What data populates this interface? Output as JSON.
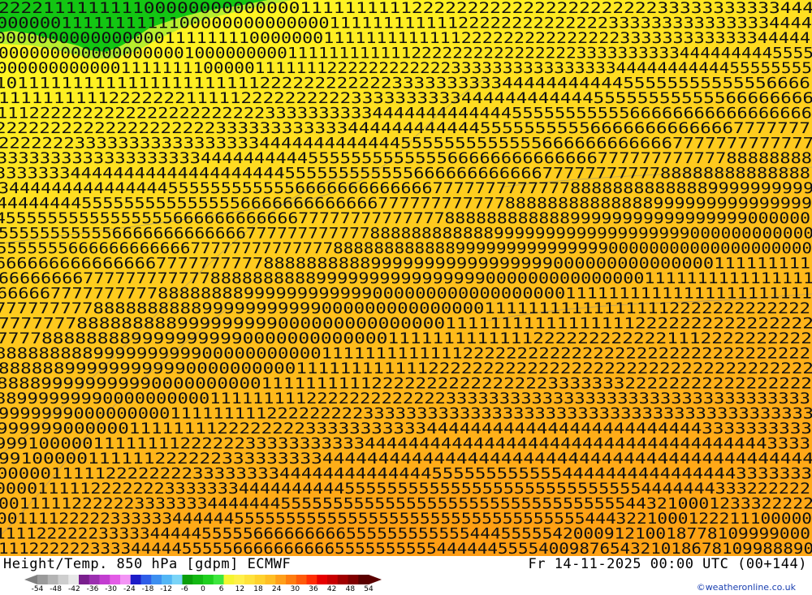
{
  "title": "Height/Temp. 850 hPa [gdpm] ECMWF",
  "valid_time": "Fr 14-11-2025 00:00 UTC (00+144)",
  "credit": "©weatheronline.co.uk",
  "legend": {
    "labels": [
      "-54",
      "-48",
      "-42",
      "-36",
      "-30",
      "-24",
      "-18",
      "-12",
      "-6",
      "0",
      "6",
      "12",
      "18",
      "24",
      "30",
      "36",
      "42",
      "48",
      "54"
    ],
    "colors": [
      "#9a9a9a",
      "#b4b4b4",
      "#cecece",
      "#e8e8e8",
      "#7a1f8e",
      "#9b2fb0",
      "#c23dd0",
      "#e35ce6",
      "#f394f5",
      "#1c1cc8",
      "#2f5ee8",
      "#3d8ff0",
      "#53b6f5",
      "#7ad4f7",
      "#0a9e0a",
      "#13b813",
      "#1fd01f",
      "#3ee63e",
      "#f5f532",
      "#fff04a",
      "#ffe23c",
      "#ffd22e",
      "#ffbe24",
      "#ff9f1a",
      "#ff7d10",
      "#ff5a0a",
      "#ff2e04",
      "#e60000",
      "#c80000",
      "#a00000",
      "#800000",
      "#5a0000"
    ]
  },
  "map": {
    "background_colors": {
      "cold_patch": "#18d018",
      "warm_yellow": "#ffff1e",
      "orange": "#ffb11a"
    },
    "digit_rows": [
      "2222111111111000000000000001111111111222222222222222222222233333333333444",
      "0000001111111111100000000000000111111111111222222222222223333333333333334444",
      "00000000000000001111111100000001111111111111222222222222222333333333333344444",
      "0000000000000000001000000000111111111111222222222222222233333333334444444445555",
      "0000000000001111111100000111111122222222222233333333333333334444444444455555555",
      "10111111111111111111111122222222222233333333334444444444455555555555556666",
      "11111111112222222111112222222222333333333344444444444455555555555566666666",
      "1112222222222222222222222333333333344444444444445555555555566666666666666666",
      "22222222222222222222333333333333444444444444555555555566666666666667777777",
      "222222233333333333333333444444444444455555555555556666666666667777777777777",
      "3333333333333333333444444444455555555555556666666666666677777777777788888888",
      "3333333444444444444444444445555555555556666666666667777777777788888888888888",
      "34444444444444445555555555556666666666666777777777777788888888888889999999999",
      "44444444555555555555555666666666666677777777777788888888888888999999999999999",
      "455555555555555556666666666667777777777777788888888888899999999999999999000000",
      "5555555555566666666666667777777777778888888888889999999999999999999000000000000",
      "55555556666666666667777777777777788888888888899999999999999900000000000000000000",
      "6666666666666667777777777888888888899999999999999999000000000000000111111111",
      "66666666777777777777888888888899999999999999990000000000000001111111111111111",
      "6666677777777778888888899999999999900000000000000000011111111111111111111111",
      "777777777888888888899999999999000000000000000111111111111111112222222222222",
      "7777777888888888999999999000000000000000111111111111111112222222222222222",
      "7777888888889999999999000000000000011111111111112222222222221112222222222",
      "888888888999999999900000000000111111111111122222222222222222222222222222222",
      "88888899999999999000000000011111111111122222222222222222222222222222222222",
      "88889999999999000000000011111111112222222222222222333333322222222222222222",
      "8899999999000000000011111111122222222222223333333333333333333333333333333333",
      "9999999000000000111111111222222222333333333333333333333333333333333333333333",
      "99999900000011111111222222223333333333344444444444444444444444443333333333",
      "999100000111111112222223333333333344444444444444444444444444444444444443333",
      "9910000011111122222233333333344444444444444444444444444444444444444444444",
      "000001111122222222333333334444444444444455555555555544444444444444443333333",
      "00001111122222223333333444444444455555555555555555555555555554444444333222222",
      "001111122222233333334444444555555555555555555555555555555555443210001233322222",
      "0011112222233333344444455555555555555555555555555555555554443221000122211100000",
      "1111222222333334444455555666666666555555555555444555554200091210018778109999000",
      "11122222233334444455555666666666655555555554444445555400987654321018678109988890"
    ],
    "dashed_line_points": "",
    "cold_patch_enabled": true
  }
}
